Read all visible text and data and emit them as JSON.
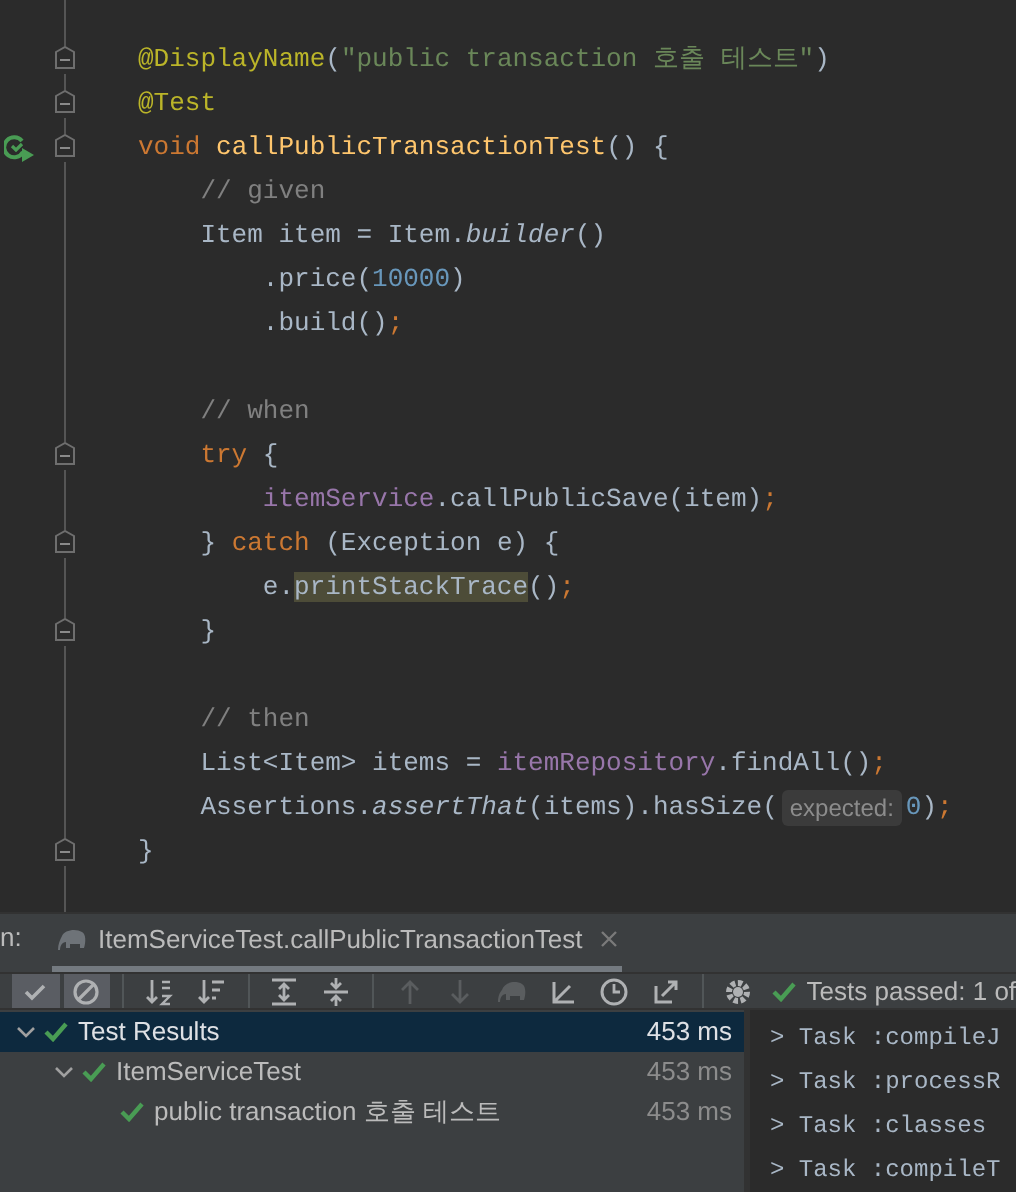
{
  "editor": {
    "lines": [
      {
        "kind": "code",
        "fold": true,
        "tokens": [
          {
            "kind": "annotation",
            "text": "@DisplayName"
          },
          {
            "kind": "plain",
            "text": "("
          },
          {
            "kind": "string",
            "text": "\"public transaction 호출 테스트\""
          },
          {
            "kind": "plain",
            "text": ")"
          }
        ]
      },
      {
        "kind": "code",
        "fold": true,
        "tokens": [
          {
            "kind": "annotation",
            "text": "@Test"
          }
        ]
      },
      {
        "kind": "code",
        "fold": true,
        "run_icon": true,
        "tokens": [
          {
            "kind": "keyword",
            "text": "void "
          },
          {
            "kind": "method",
            "text": "callPublicTransactionTest"
          },
          {
            "kind": "plain",
            "text": "() {"
          }
        ]
      },
      {
        "kind": "code",
        "tokens": [
          {
            "kind": "comment",
            "text": "    // given"
          }
        ]
      },
      {
        "kind": "code",
        "tokens": [
          {
            "kind": "plain",
            "text": "    Item item = Item."
          },
          {
            "kind": "static",
            "text": "builder"
          },
          {
            "kind": "plain",
            "text": "()"
          }
        ]
      },
      {
        "kind": "code",
        "tokens": [
          {
            "kind": "plain",
            "text": "        .price("
          },
          {
            "kind": "number",
            "text": "10000"
          },
          {
            "kind": "plain",
            "text": ")"
          }
        ]
      },
      {
        "kind": "code",
        "tokens": [
          {
            "kind": "plain",
            "text": "        .build()"
          },
          {
            "kind": "keyword",
            "text": ";"
          }
        ]
      },
      {
        "kind": "blank"
      },
      {
        "kind": "code",
        "tokens": [
          {
            "kind": "comment",
            "text": "    // when"
          }
        ]
      },
      {
        "kind": "code",
        "fold": true,
        "tokens": [
          {
            "kind": "keyword",
            "text": "    try "
          },
          {
            "kind": "plain",
            "text": "{"
          }
        ]
      },
      {
        "kind": "code",
        "tokens": [
          {
            "kind": "field",
            "text": "        itemService"
          },
          {
            "kind": "plain",
            "text": ".callPublicSave(item)"
          },
          {
            "kind": "keyword",
            "text": ";"
          }
        ]
      },
      {
        "kind": "code",
        "fold": true,
        "tokens": [
          {
            "kind": "plain",
            "text": "    } "
          },
          {
            "kind": "keyword",
            "text": "catch "
          },
          {
            "kind": "plain",
            "text": "(Exception e) {"
          }
        ]
      },
      {
        "kind": "code",
        "tokens": [
          {
            "kind": "plain",
            "text": "        e."
          },
          {
            "kind": "highlight",
            "text": "printStackTrace"
          },
          {
            "kind": "plain",
            "text": "()"
          },
          {
            "kind": "keyword",
            "text": ";"
          }
        ]
      },
      {
        "kind": "code",
        "fold": true,
        "tokens": [
          {
            "kind": "plain",
            "text": "    }"
          }
        ]
      },
      {
        "kind": "blank"
      },
      {
        "kind": "code",
        "tokens": [
          {
            "kind": "comment",
            "text": "    // then"
          }
        ]
      },
      {
        "kind": "code",
        "tokens": [
          {
            "kind": "plain",
            "text": "    List<Item> items = "
          },
          {
            "kind": "field",
            "text": "itemRepository"
          },
          {
            "kind": "plain",
            "text": ".findAll()"
          },
          {
            "kind": "keyword",
            "text": ";"
          }
        ]
      },
      {
        "kind": "code",
        "tokens": [
          {
            "kind": "plain",
            "text": "    Assertions."
          },
          {
            "kind": "static",
            "text": "assertThat"
          },
          {
            "kind": "plain",
            "text": "(items).hasSize("
          },
          {
            "kind": "hint",
            "text": "expected:"
          },
          {
            "kind": "number",
            "text": "0"
          },
          {
            "kind": "plain",
            "text": ")"
          },
          {
            "kind": "keyword",
            "text": ";"
          }
        ]
      },
      {
        "kind": "code",
        "fold": true,
        "tokens": [
          {
            "kind": "plain",
            "text": "}"
          }
        ]
      }
    ]
  },
  "run_panel": {
    "label": "n:",
    "tab": {
      "title": "ItemServiceTest.callPublicTransactionTest",
      "selected": true
    },
    "toolbar": [
      {
        "kind": "check",
        "selected": true,
        "disabled": false
      },
      {
        "kind": "stop",
        "selected": true,
        "disabled": false
      },
      {
        "kind": "sep"
      },
      {
        "kind": "sort-alpha",
        "selected": false,
        "disabled": false
      },
      {
        "kind": "sort-duration",
        "selected": false,
        "disabled": false
      },
      {
        "kind": "sep"
      },
      {
        "kind": "expand",
        "selected": false,
        "disabled": false
      },
      {
        "kind": "collapse",
        "selected": false,
        "disabled": false
      },
      {
        "kind": "sep"
      },
      {
        "kind": "up",
        "selected": false,
        "disabled": true
      },
      {
        "kind": "down",
        "selected": false,
        "disabled": true
      },
      {
        "kind": "elephant",
        "selected": false,
        "disabled": true
      },
      {
        "kind": "import",
        "selected": false,
        "disabled": false
      },
      {
        "kind": "history",
        "selected": false,
        "disabled": false
      },
      {
        "kind": "export",
        "selected": false,
        "disabled": false
      },
      {
        "kind": "sep"
      },
      {
        "kind": "gear",
        "selected": false,
        "disabled": false
      }
    ],
    "status": "Tests passed: 1 of",
    "tree": [
      {
        "label": "Test Results",
        "time": "453 ms",
        "selected": true,
        "expanded": true,
        "children": [
          {
            "label": "ItemServiceTest",
            "time": "453 ms",
            "selected": false,
            "expanded": true,
            "children": [
              {
                "label": "public transaction 호출 테스트",
                "time": "453 ms",
                "selected": false
              }
            ]
          }
        ]
      }
    ],
    "console": [
      "> Task :compileJ",
      "> Task :processR",
      "> Task :classes",
      "> Task :compileT"
    ]
  }
}
